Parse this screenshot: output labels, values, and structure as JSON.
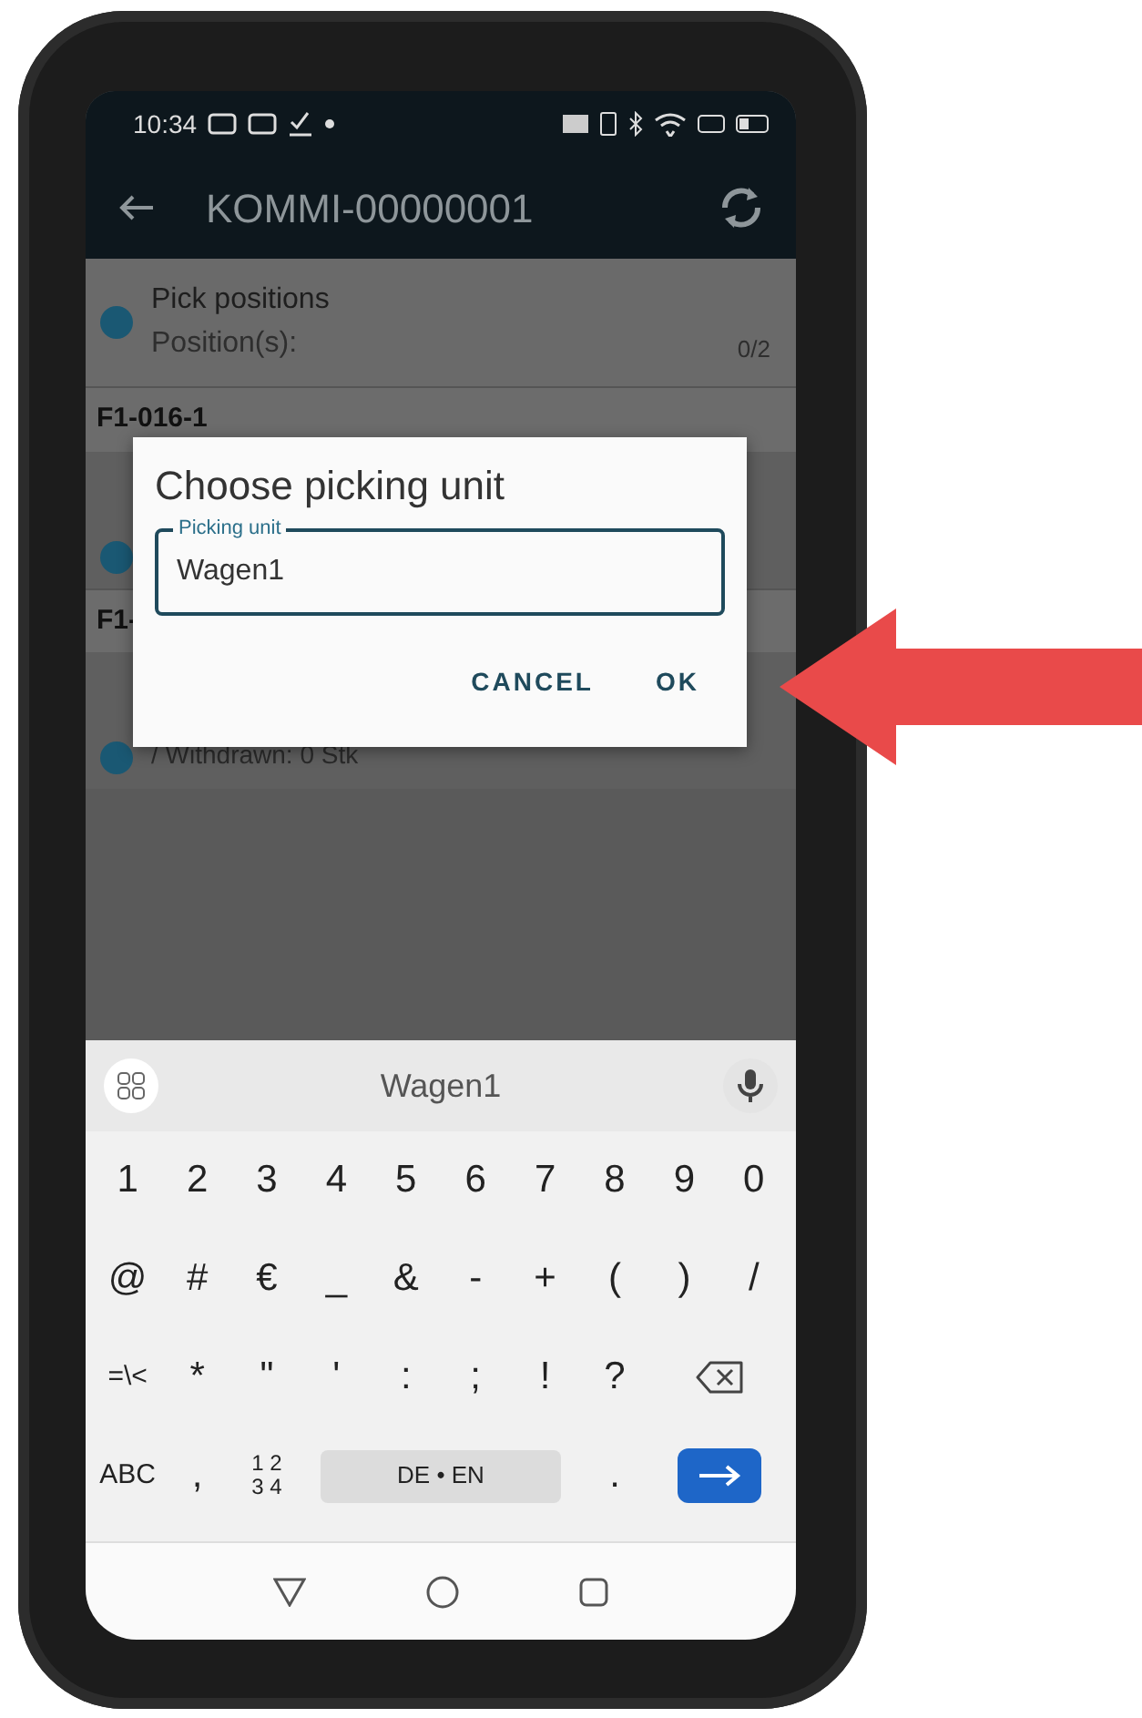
{
  "status_bar": {
    "time": "10:34"
  },
  "app_bar": {
    "title": "KOMMI-00000001"
  },
  "summary": {
    "title": "Pick positions",
    "label": "Position(s):",
    "count": "0/2"
  },
  "groups": [
    {
      "header": "F1-016-1"
    },
    {
      "header": "F1-",
      "lines": [
        "/ Withdrawn: 0 Stk"
      ]
    }
  ],
  "dialog": {
    "title": "Choose picking unit",
    "field": {
      "label": "Picking unit",
      "value": "Wagen1"
    },
    "buttons": [
      "CANCEL",
      "OK"
    ]
  },
  "keyboard": {
    "suggestion": "Wagen1",
    "rows": [
      [
        {
          "kind": "key",
          "label": "1"
        },
        {
          "kind": "key",
          "label": "2"
        },
        {
          "kind": "key",
          "label": "3"
        },
        {
          "kind": "key",
          "label": "4"
        },
        {
          "kind": "key",
          "label": "5"
        },
        {
          "kind": "key",
          "label": "6"
        },
        {
          "kind": "key",
          "label": "7"
        },
        {
          "kind": "key",
          "label": "8"
        },
        {
          "kind": "key",
          "label": "9"
        },
        {
          "kind": "key",
          "label": "0"
        }
      ],
      [
        {
          "kind": "key",
          "label": "@"
        },
        {
          "kind": "key",
          "label": "#"
        },
        {
          "kind": "key",
          "label": "€"
        },
        {
          "kind": "key",
          "label": "_"
        },
        {
          "kind": "key",
          "label": "&"
        },
        {
          "kind": "key",
          "label": "-"
        },
        {
          "kind": "key",
          "label": "+"
        },
        {
          "kind": "key",
          "label": "("
        },
        {
          "kind": "key",
          "label": ")"
        },
        {
          "kind": "key",
          "label": "/"
        }
      ],
      [
        {
          "kind": "small",
          "label": "=\\<"
        },
        {
          "kind": "key",
          "label": "*"
        },
        {
          "kind": "key",
          "label": "\""
        },
        {
          "kind": "key",
          "label": "'"
        },
        {
          "kind": "key",
          "label": ":"
        },
        {
          "kind": "key",
          "label": ";"
        },
        {
          "kind": "key",
          "label": "!"
        },
        {
          "kind": "key",
          "label": "?"
        },
        {
          "kind": "backspace"
        }
      ]
    ],
    "bottom_row": [
      {
        "kind": "small",
        "label": "ABC"
      },
      {
        "kind": "key",
        "label": ","
      },
      {
        "kind": "stack",
        "lines": [
          "1 2",
          "3 4"
        ]
      },
      {
        "kind": "space",
        "label": "DE • EN"
      },
      {
        "kind": "key",
        "label": "."
      },
      {
        "kind": "enter"
      }
    ]
  }
}
